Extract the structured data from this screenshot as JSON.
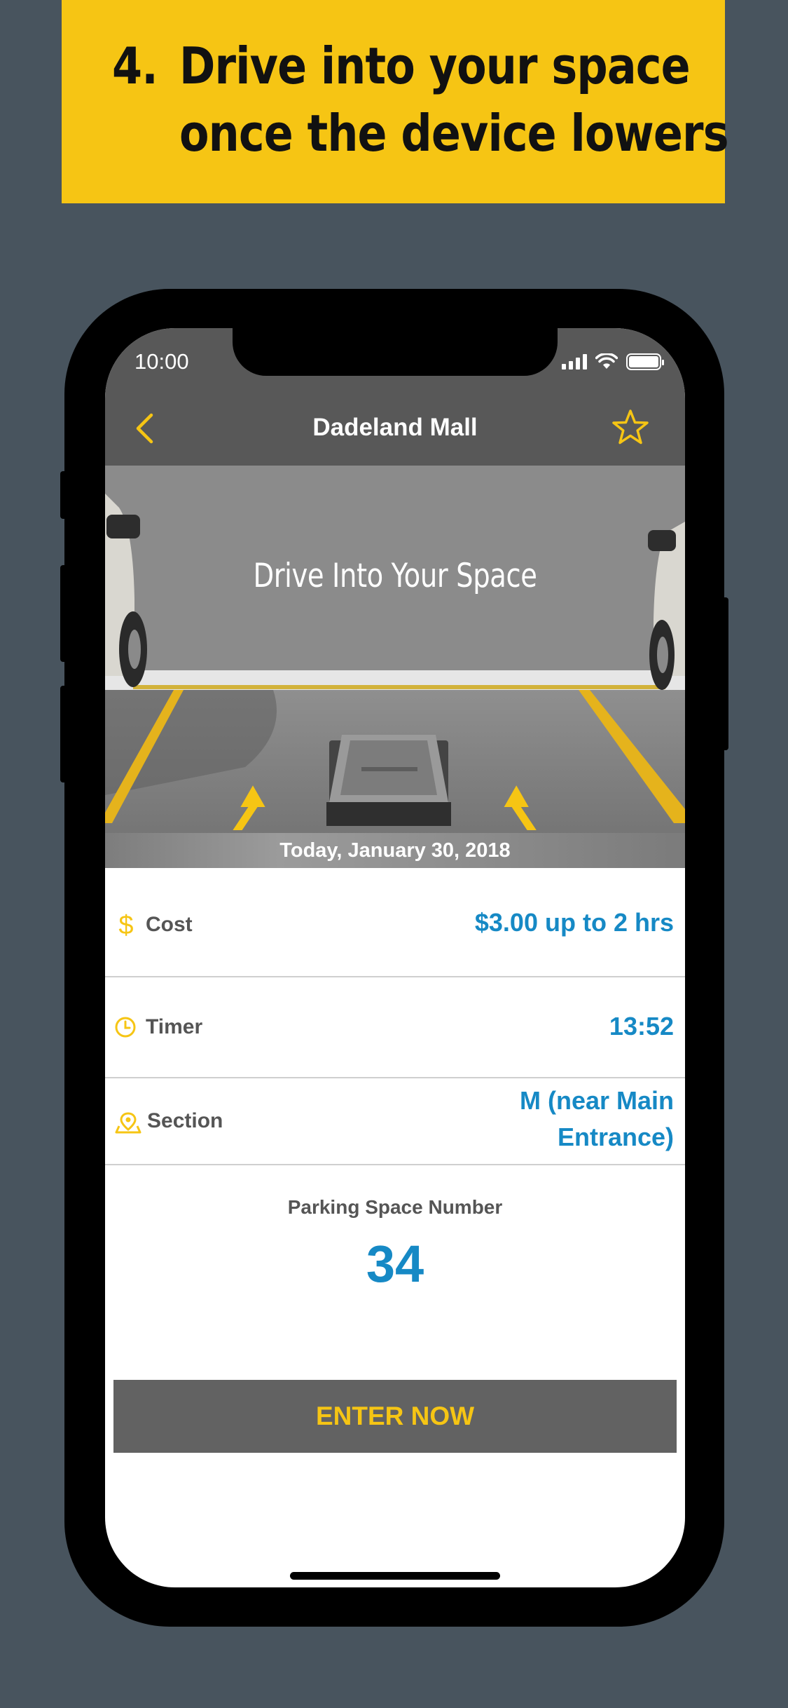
{
  "banner": {
    "step_number": "4.",
    "line1": "Drive into your space",
    "line2": "once the device lowers"
  },
  "status_bar": {
    "time": "10:00"
  },
  "nav": {
    "title": "Dadeland Mall",
    "back_icon": "chevron-left-icon",
    "favorite_icon": "star-outline-icon"
  },
  "hero": {
    "caption": "Drive Into Your Space",
    "date": "Today, January 30, 2018"
  },
  "details": {
    "cost": {
      "label": "Cost",
      "value": "$3.00 up to 2 hrs",
      "icon": "dollar-icon"
    },
    "timer": {
      "label": "Timer",
      "value": "13:52",
      "icon": "clock-icon"
    },
    "section": {
      "label": "Section",
      "value_line1": "M (near Main",
      "value_line2": "Entrance)",
      "icon": "location-icon"
    }
  },
  "space": {
    "label": "Parking Space Number",
    "number": "34"
  },
  "cta": {
    "label": "ENTER NOW"
  },
  "colors": {
    "accent_yellow": "#f6c514",
    "value_blue": "#1689c5",
    "nav_gray": "#585858",
    "background": "#48545e"
  }
}
